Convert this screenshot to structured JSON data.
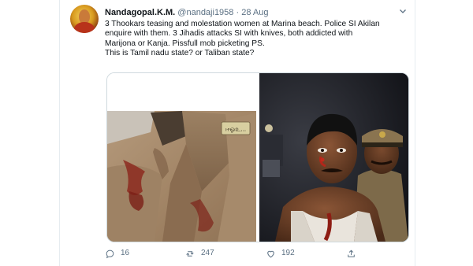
{
  "tweet": {
    "author_name": "Nandagopal.K.M.",
    "handle": "@nandaji1958",
    "separator": "·",
    "date": "28 Aug",
    "lines": [
      "3 Thookars teasing and molestation women at Marina beach. Police SI Akilan",
      "enquire with them. 3 Jihadis attacks SI with knives, both addicted with",
      "Marijona or Kanja. Pissfull mob picketing PS.",
      "This is Tamil nadu state? or Taliban state?"
    ],
    "media": {
      "left_image_icon": "photo-bloodstained-uniform",
      "left_badge_text": "ஈஓஉ...",
      "right_image_icon": "photo-injured-man-and-police-officer"
    },
    "actions": {
      "reply_count": "16",
      "retweet_count": "247",
      "like_count": "192"
    },
    "icons": [
      "more-options-caret-icon",
      "reply-icon",
      "retweet-icon",
      "like-icon",
      "share-icon"
    ],
    "colors": {
      "text": "#0f1419",
      "meta": "#5b7083",
      "border": "#cfd9de"
    }
  }
}
